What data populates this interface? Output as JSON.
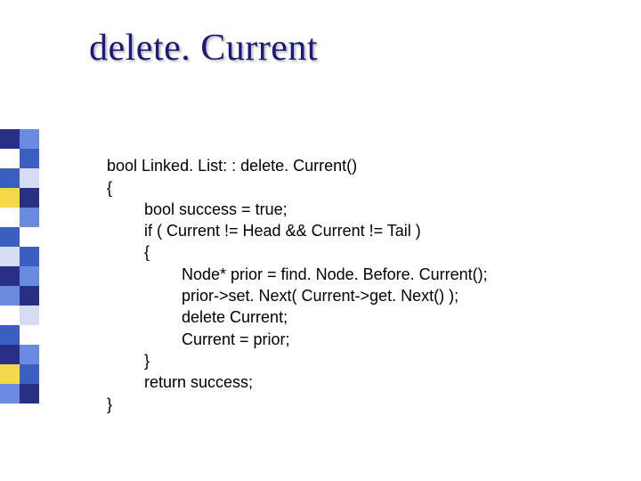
{
  "title": "delete. Current",
  "code": {
    "l0": "bool Linked. List: : delete. Current()",
    "l1": "{",
    "l2": "bool success = true;",
    "l3": "if ( Current != Head && Current != Tail )",
    "l4": "{",
    "l5": "Node* prior = find. Node. Before. Current();",
    "l6": "prior->set. Next( Current->get. Next() );",
    "l7": "delete Current;",
    "l8": "Current = prior;",
    "l9": "}",
    "l10": "return success;",
    "l11": "}"
  },
  "palette": {
    "navy": "#2a2f86",
    "blue": "#3b5fc1",
    "light": "#6a8be0",
    "pale": "#d6dcf2",
    "white": "#ffffff",
    "yellow": "#f6d94b"
  }
}
